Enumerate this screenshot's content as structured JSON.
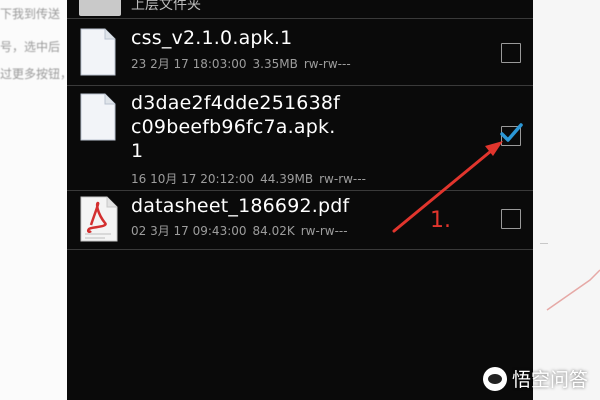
{
  "background_text": [
    "下我到传送",
    "号，选中后",
    "过更多按钮，"
  ],
  "parent_folder": {
    "label": "上层文件夹",
    "icon": "folder-icon"
  },
  "files": [
    {
      "name_lines": [
        "css_v2.1.0.apk.1"
      ],
      "date": "23 2月 17 18:03:00",
      "size": "3.35MB",
      "perms": "rw-rw---",
      "icon": "document-icon",
      "checked": false
    },
    {
      "name_lines": [
        "d3dae2f4dde251638f",
        "c09beefb96fc7a.apk.",
        "1"
      ],
      "date": "16 10月 17 20:12:00",
      "size": "44.39MB",
      "perms": "rw-rw---",
      "icon": "document-icon",
      "checked": true
    },
    {
      "name_lines": [
        "datasheet_186692.pdf"
      ],
      "date": "02 3月 17 09:43:00",
      "size": "84.02K",
      "perms": "rw-rw---",
      "icon": "pdf-icon",
      "checked": false
    }
  ],
  "annotation": {
    "label": "1.",
    "color": "#e1352d"
  },
  "watermark": {
    "text": "悟空问答",
    "icon": "wukong-logo-icon"
  },
  "colors": {
    "checkmark": "#2b97d6",
    "accent_red": "#e1352d",
    "screen_bg": "#0a0a0a"
  }
}
